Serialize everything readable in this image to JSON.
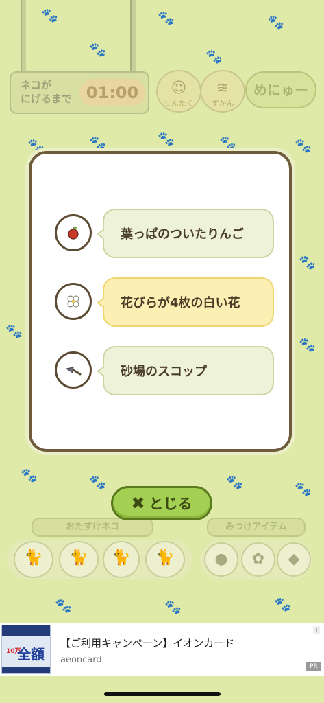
{
  "game": {
    "timer_label": "ネコが\nにげるまで",
    "timer_value": "01:00",
    "top_buttons": [
      {
        "label": "せんたく",
        "icon": "cat-face-icon"
      },
      {
        "label": "ずかん",
        "icon": "fish-icon"
      }
    ],
    "menu_label": "めにゅー",
    "recommend_cats_label": "おたすけネコ",
    "items_label": "みつけアイテム"
  },
  "dialog": {
    "items": [
      {
        "label": "葉っぱのついたりんご",
        "icon": "apple-icon",
        "active": false
      },
      {
        "label": "花びらが4枚の白い花",
        "icon": "flower-icon",
        "active": true
      },
      {
        "label": "砂場のスコップ",
        "icon": "shovel-icon",
        "active": false
      }
    ],
    "close_label": "とじる"
  },
  "ad": {
    "title": "【ご利用キャンペーン】イオンカード",
    "domain": "aeoncard",
    "badge": "PR",
    "thumb_text": "全額",
    "thumb_sub": "10万"
  },
  "colors": {
    "background": "#dfe9a8",
    "dialog_border": "#6e5b3c",
    "active_bubble": "#fbefb4",
    "close_button": "#a3cf52"
  }
}
